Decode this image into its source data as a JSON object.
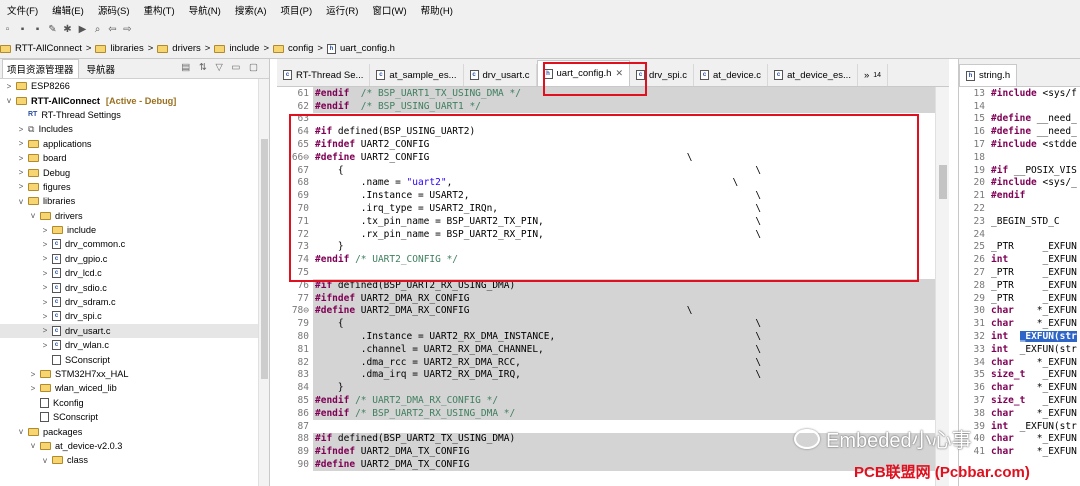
{
  "menu": [
    "文件(F)",
    "编辑(E)",
    "源码(S)",
    "重构(T)",
    "导航(N)",
    "搜索(A)",
    "项目(P)",
    "运行(R)",
    "窗口(W)",
    "帮助(H)"
  ],
  "breadcrumb": [
    "RTT-AllConnect",
    "libraries",
    "drivers",
    "include",
    "config",
    "uart_config.h"
  ],
  "left_panel": {
    "tab_active": "项目资源管理器",
    "tab_inactive": "导航器",
    "tree": [
      {
        "label": "ESP8266",
        "depth": 0,
        "twisty": ">",
        "icon": "project"
      },
      {
        "label": "RTT-AllConnect",
        "suffix": "[Active - Debug]",
        "depth": 0,
        "twisty": "v",
        "icon": "project"
      },
      {
        "label": "RT-Thread Settings",
        "depth": 1,
        "twisty": "",
        "icon": "rtt"
      },
      {
        "label": "Includes",
        "depth": 1,
        "twisty": ">",
        "icon": "includes"
      },
      {
        "label": "applications",
        "depth": 1,
        "twisty": ">",
        "icon": "folder"
      },
      {
        "label": "board",
        "depth": 1,
        "twisty": ">",
        "icon": "folder"
      },
      {
        "label": "Debug",
        "depth": 1,
        "twisty": ">",
        "icon": "folder"
      },
      {
        "label": "figures",
        "depth": 1,
        "twisty": ">",
        "icon": "folder"
      },
      {
        "label": "libraries",
        "depth": 1,
        "twisty": "v",
        "icon": "folder"
      },
      {
        "label": "drivers",
        "depth": 2,
        "twisty": "v",
        "icon": "folder"
      },
      {
        "label": "include",
        "depth": 3,
        "twisty": ">",
        "icon": "folder"
      },
      {
        "label": "drv_common.c",
        "depth": 3,
        "twisty": ">",
        "icon": "c"
      },
      {
        "label": "drv_gpio.c",
        "depth": 3,
        "twisty": ">",
        "icon": "c"
      },
      {
        "label": "drv_lcd.c",
        "depth": 3,
        "twisty": ">",
        "icon": "c"
      },
      {
        "label": "drv_sdio.c",
        "depth": 3,
        "twisty": ">",
        "icon": "c"
      },
      {
        "label": "drv_sdram.c",
        "depth": 3,
        "twisty": ">",
        "icon": "c"
      },
      {
        "label": "drv_spi.c",
        "depth": 3,
        "twisty": ">",
        "icon": "c"
      },
      {
        "label": "drv_usart.c",
        "depth": 3,
        "twisty": ">",
        "icon": "c",
        "selected": true
      },
      {
        "label": "drv_wlan.c",
        "depth": 3,
        "twisty": ">",
        "icon": "c"
      },
      {
        "label": "SConscript",
        "depth": 3,
        "twisty": "",
        "icon": "file"
      },
      {
        "label": "STM32H7xx_HAL",
        "depth": 2,
        "twisty": ">",
        "icon": "folder"
      },
      {
        "label": "wlan_wiced_lib",
        "depth": 2,
        "twisty": ">",
        "icon": "folder"
      },
      {
        "label": "Kconfig",
        "depth": 2,
        "twisty": "",
        "icon": "file"
      },
      {
        "label": "SConscript",
        "depth": 2,
        "twisty": "",
        "icon": "file"
      },
      {
        "label": "packages",
        "depth": 1,
        "twisty": "v",
        "icon": "folder"
      },
      {
        "label": "at_device-v2.0.3",
        "depth": 2,
        "twisty": "v",
        "icon": "folder"
      },
      {
        "label": "class",
        "depth": 3,
        "twisty": "v",
        "icon": "folder"
      }
    ]
  },
  "editor": {
    "tabs": [
      {
        "label": "RT-Thread Se...",
        "active": false
      },
      {
        "label": "at_sample_es...",
        "active": false
      },
      {
        "label": "drv_usart.c",
        "active": false
      },
      {
        "label": "uart_config.h",
        "active": true
      },
      {
        "label": "drv_spi.c",
        "active": false
      },
      {
        "label": "at_device.c",
        "active": false
      },
      {
        "label": "at_device_es...",
        "active": false
      }
    ],
    "overflow_label": "»",
    "overflow_count": "14",
    "lines": [
      {
        "n": "61",
        "hl": true,
        "toks": [
          [
            "kw",
            "#endif"
          ],
          [
            "",
            "  "
          ],
          [
            "cm",
            "/* BSP_UART1_TX_USING_DMA */"
          ]
        ]
      },
      {
        "n": "62",
        "hl": true,
        "toks": [
          [
            "kw",
            "#endif"
          ],
          [
            "",
            "  "
          ],
          [
            "cm",
            "/* BSP_USING_UART1 */"
          ]
        ]
      },
      {
        "n": "63",
        "hl": false,
        "toks": []
      },
      {
        "n": "64",
        "hl": false,
        "toks": [
          [
            "kw",
            "#if"
          ],
          [
            "",
            " defined(BSP_USING_UART2)"
          ]
        ]
      },
      {
        "n": "65",
        "hl": false,
        "toks": [
          [
            "kw",
            "#ifndef"
          ],
          [
            "",
            " UART2_CONFIG"
          ]
        ]
      },
      {
        "n": "66⊖",
        "hl": false,
        "toks": [
          [
            "kw",
            "#define"
          ],
          [
            "",
            " UART2_CONFIG                                             \\"
          ]
        ]
      },
      {
        "n": "67",
        "hl": false,
        "toks": [
          [
            "",
            "    {                                                                        \\"
          ]
        ]
      },
      {
        "n": "68",
        "hl": false,
        "toks": [
          [
            "",
            "        .name = "
          ],
          [
            "st",
            "\"uart2\""
          ],
          [
            "",
            ",                                                 \\"
          ]
        ]
      },
      {
        "n": "69",
        "hl": false,
        "toks": [
          [
            "",
            "        .Instance = USART2,                                                  \\"
          ]
        ]
      },
      {
        "n": "70",
        "hl": false,
        "toks": [
          [
            "",
            "        .irq_type = USART2_IRQn,                                             \\"
          ]
        ]
      },
      {
        "n": "71",
        "hl": false,
        "toks": [
          [
            "",
            "        .tx_pin_name = BSP_UART2_TX_PIN,                                     \\"
          ]
        ]
      },
      {
        "n": "72",
        "hl": false,
        "toks": [
          [
            "",
            "        .rx_pin_name = BSP_UART2_RX_PIN,                                     \\"
          ]
        ]
      },
      {
        "n": "73",
        "hl": false,
        "toks": [
          [
            "",
            "    }"
          ]
        ]
      },
      {
        "n": "74",
        "hl": false,
        "toks": [
          [
            "kw",
            "#endif"
          ],
          [
            "",
            " "
          ],
          [
            "cm",
            "/* UART2_CONFIG */"
          ]
        ]
      },
      {
        "n": "75",
        "hl": false,
        "toks": []
      },
      {
        "n": "76",
        "hl": true,
        "toks": [
          [
            "kw",
            "#if"
          ],
          [
            "",
            " defined(BSP_UART2_RX_USING_DMA)"
          ]
        ]
      },
      {
        "n": "77",
        "hl": true,
        "toks": [
          [
            "kw",
            "#ifndef"
          ],
          [
            "",
            " UART2_DMA_RX_CONFIG"
          ]
        ]
      },
      {
        "n": "78⊖",
        "hl": true,
        "toks": [
          [
            "kw",
            "#define"
          ],
          [
            "",
            " UART2_DMA_RX_CONFIG                                      \\"
          ]
        ]
      },
      {
        "n": "79",
        "hl": true,
        "toks": [
          [
            "",
            "    {                                                                        \\"
          ]
        ]
      },
      {
        "n": "80",
        "hl": true,
        "toks": [
          [
            "",
            "        .Instance = UART2_RX_DMA_INSTANCE,                                   \\"
          ]
        ]
      },
      {
        "n": "81",
        "hl": true,
        "toks": [
          [
            "",
            "        .channel = UART2_RX_DMA_CHANNEL,                                     \\"
          ]
        ]
      },
      {
        "n": "82",
        "hl": true,
        "toks": [
          [
            "",
            "        .dma_rcc = UART2_RX_DMA_RCC,                                         \\"
          ]
        ]
      },
      {
        "n": "83",
        "hl": true,
        "toks": [
          [
            "",
            "        .dma_irq = UART2_RX_DMA_IRQ,                                         \\"
          ]
        ]
      },
      {
        "n": "84",
        "hl": true,
        "toks": [
          [
            "",
            "    }"
          ]
        ]
      },
      {
        "n": "85",
        "hl": true,
        "toks": [
          [
            "kw",
            "#endif"
          ],
          [
            "",
            " "
          ],
          [
            "cm",
            "/* UART2_DMA_RX_CONFIG */"
          ]
        ]
      },
      {
        "n": "86",
        "hl": true,
        "toks": [
          [
            "kw",
            "#endif"
          ],
          [
            "",
            " "
          ],
          [
            "cm",
            "/* BSP_UART2_RX_USING_DMA */"
          ]
        ]
      },
      {
        "n": "87",
        "hl": false,
        "toks": []
      },
      {
        "n": "88",
        "hl": true,
        "toks": [
          [
            "kw",
            "#if"
          ],
          [
            "",
            " defined(BSP_UART2_TX_USING_DMA)"
          ]
        ]
      },
      {
        "n": "89",
        "hl": true,
        "toks": [
          [
            "kw",
            "#ifndef"
          ],
          [
            "",
            " UART2_DMA_TX_CONFIG"
          ]
        ]
      },
      {
        "n": "90",
        "hl": true,
        "toks": [
          [
            "kw",
            "#define"
          ],
          [
            "",
            " UART2_DMA_TX_CONFIG"
          ]
        ]
      }
    ]
  },
  "right_panel": {
    "tab_label": "string.h",
    "lines": [
      {
        "n": "13",
        "toks": [
          [
            "kw",
            "#include"
          ],
          [
            "",
            " <sys/f"
          ]
        ]
      },
      {
        "n": "14",
        "toks": []
      },
      {
        "n": "15",
        "toks": [
          [
            "kw",
            "#define"
          ],
          [
            "",
            " __need_"
          ]
        ]
      },
      {
        "n": "16",
        "toks": [
          [
            "kw",
            "#define"
          ],
          [
            "",
            " __need_"
          ]
        ]
      },
      {
        "n": "17",
        "toks": [
          [
            "kw",
            "#include"
          ],
          [
            "",
            " <stdde"
          ]
        ]
      },
      {
        "n": "18",
        "toks": []
      },
      {
        "n": "19",
        "toks": [
          [
            "kw",
            "#if"
          ],
          [
            "",
            " __POSIX_VIS"
          ]
        ]
      },
      {
        "n": "20",
        "toks": [
          [
            "kw",
            "#include"
          ],
          [
            "",
            " <sys/_"
          ]
        ]
      },
      {
        "n": "21",
        "toks": [
          [
            "kw",
            "#endif"
          ]
        ]
      },
      {
        "n": "22",
        "toks": []
      },
      {
        "n": "23",
        "toks": [
          [
            "",
            "_BEGIN_STD_C"
          ]
        ]
      },
      {
        "n": "24",
        "toks": []
      },
      {
        "n": "25",
        "toks": [
          [
            "",
            "_PTR     _EXFUN"
          ]
        ]
      },
      {
        "n": "26",
        "toks": [
          [
            "kw",
            "int"
          ],
          [
            "",
            "      _EXFUN"
          ]
        ]
      },
      {
        "n": "27",
        "toks": [
          [
            "",
            "_PTR     _EXFUN"
          ]
        ]
      },
      {
        "n": "28",
        "toks": [
          [
            "",
            "_PTR     _EXFUN"
          ]
        ]
      },
      {
        "n": "29",
        "toks": [
          [
            "",
            "_PTR     _EXFUN"
          ]
        ]
      },
      {
        "n": "30",
        "toks": [
          [
            "kw",
            "char"
          ],
          [
            "",
            "    *_EXFUN"
          ]
        ]
      },
      {
        "n": "31",
        "toks": [
          [
            "kw",
            "char"
          ],
          [
            "",
            "    *_EXFUN"
          ]
        ]
      },
      {
        "n": "32",
        "toks": [
          [
            "kw",
            "int"
          ],
          [
            "",
            "  "
          ],
          [
            "selw",
            "_EXFUN(str"
          ]
        ]
      },
      {
        "n": "33",
        "toks": [
          [
            "kw",
            "int"
          ],
          [
            "",
            "  _EXFUN(str"
          ]
        ]
      },
      {
        "n": "34",
        "toks": [
          [
            "kw",
            "char"
          ],
          [
            "",
            "    *_EXFUN"
          ]
        ]
      },
      {
        "n": "35",
        "toks": [
          [
            "kw",
            "size_t"
          ],
          [
            "",
            "   _EXFUN"
          ]
        ]
      },
      {
        "n": "36",
        "toks": [
          [
            "kw",
            "char"
          ],
          [
            "",
            "    *_EXFUN"
          ]
        ]
      },
      {
        "n": "37",
        "toks": [
          [
            "kw",
            "size_t"
          ],
          [
            "",
            "   _EXFUN"
          ]
        ]
      },
      {
        "n": "38",
        "toks": [
          [
            "kw",
            "char"
          ],
          [
            "",
            "    *_EXFUN"
          ]
        ]
      },
      {
        "n": "39",
        "toks": [
          [
            "kw",
            "int"
          ],
          [
            "",
            "  _EXFUN(str"
          ]
        ]
      },
      {
        "n": "40",
        "toks": [
          [
            "kw",
            "char"
          ],
          [
            "",
            "    *_EXFUN"
          ]
        ]
      },
      {
        "n": "41",
        "toks": [
          [
            "kw",
            "char"
          ],
          [
            "",
            "    *_EXFUN"
          ]
        ]
      }
    ]
  },
  "watermark": "Embeded小心事",
  "footer_text": "PCB联盟网 (Pcbbar.com)"
}
